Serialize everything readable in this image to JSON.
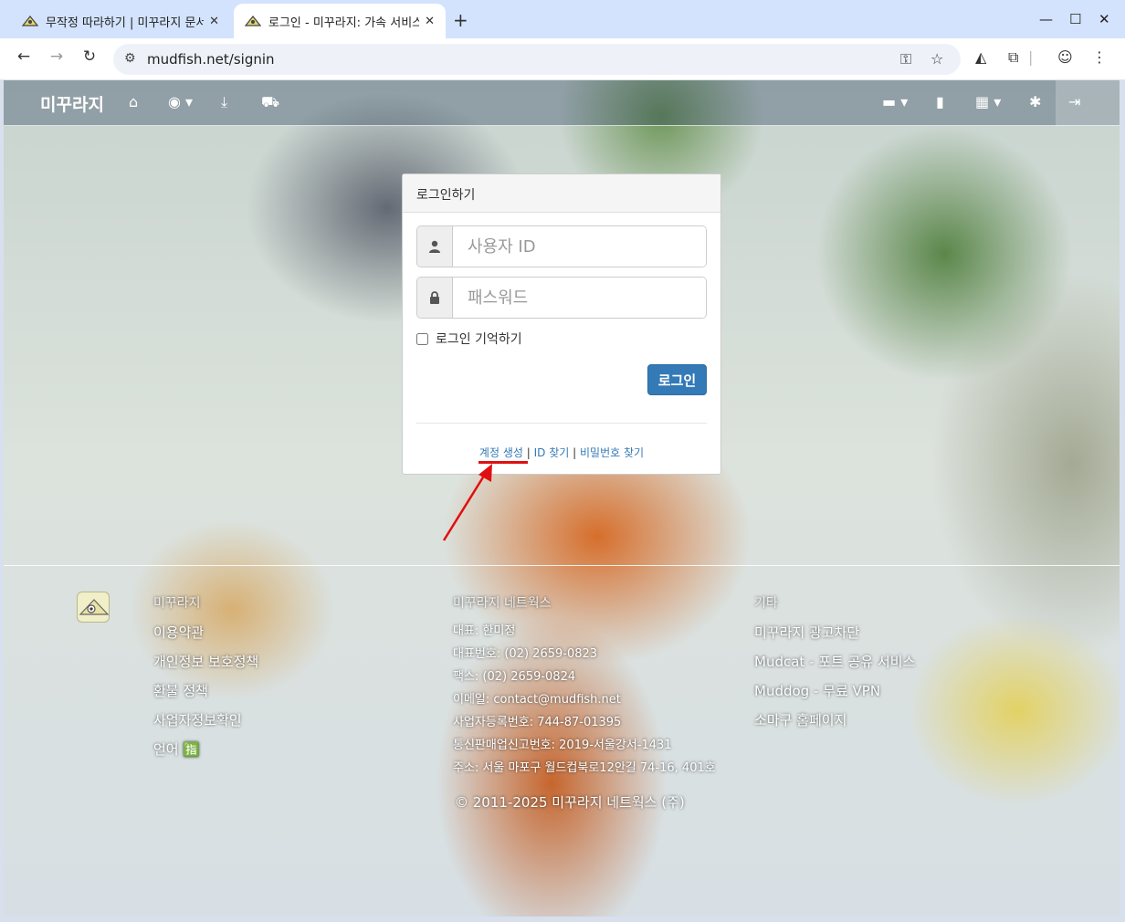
{
  "browser": {
    "tabs": [
      {
        "title": "무작정 따라하기 | 미꾸라지 문서",
        "active": false
      },
      {
        "title": "로그인 - 미꾸라지: 가속 서비스",
        "active": true
      }
    ],
    "new_tab_glyph": "+",
    "url": "mudfish.net/signin",
    "icons": [
      "back-arrow-icon",
      "forward-arrow-icon",
      "reload-icon",
      "site-info-icon",
      "password-key-icon",
      "bookmark-star-icon",
      "extension-icon",
      "puzzle-icon",
      "profile-avatar-icon",
      "menu-dots-icon"
    ]
  },
  "navbar": {
    "brand": "미꾸라지",
    "icons": [
      "home-icon",
      "globe-icon",
      "download-icon",
      "cart-icon",
      "chat-icon",
      "book-icon",
      "apps-grid-icon",
      "asterisk-icon",
      "login-icon"
    ]
  },
  "login_panel": {
    "heading": "로그인하기",
    "username_placeholder": "사용자 ID",
    "password_placeholder": "패스워드",
    "remember_label": "로그인 기억하기",
    "submit_label": "로그인",
    "links": {
      "create_account": "계정 생성",
      "separator": "|",
      "find_id": "ID 찾기",
      "find_password": "비밀번호 찾기"
    }
  },
  "footer": {
    "col1": {
      "heading": "미꾸라지",
      "items": [
        "이용약관",
        "개인정보 보호정책",
        "환불 정책",
        "사업자정보확인",
        "언어 🈯"
      ]
    },
    "col2": {
      "heading": "미꾸라지 네트웍스",
      "items": [
        "대표: 한미정",
        "대표번호: (02) 2659-0823",
        "팩스: (02) 2659-0824",
        "이메일: contact@mudfish.net",
        "사업자등록번호: 744-87-01395",
        "통신판매업신고번호: 2019-서울강서-1431",
        "주소: 서울 마포구 월드컵북로12안길 74-16, 401호"
      ]
    },
    "col3": {
      "heading": "기타",
      "items": [
        "미꾸라지 광고차단",
        "Mudcat - 포트 공유 서비스",
        "Muddog - 무료 VPN",
        "소마구 홈페이지"
      ]
    },
    "copyright": "© 2011-2025 미꾸라지 네트웍스 (주)"
  },
  "annotation": {
    "color": "#e01010"
  }
}
